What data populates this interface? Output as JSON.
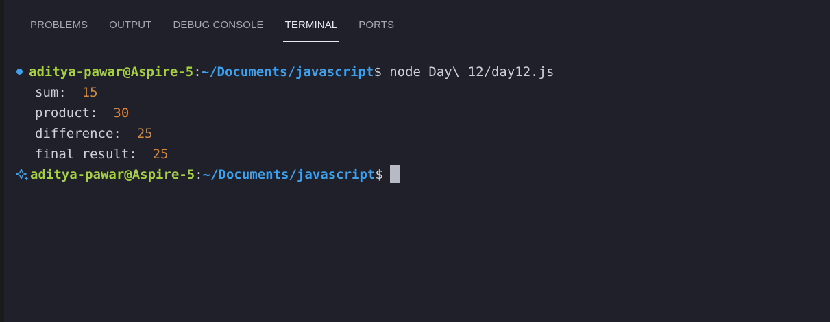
{
  "tabs": [
    {
      "label": "PROBLEMS"
    },
    {
      "label": "OUTPUT"
    },
    {
      "label": "DEBUG CONSOLE"
    },
    {
      "label": "TERMINAL",
      "active": true
    },
    {
      "label": "PORTS"
    }
  ],
  "terminal": {
    "prompt": {
      "user_host": "aditya-pawar@Aspire-5",
      "colon": ":",
      "path": "~/Documents/javascript",
      "dollar": "$"
    },
    "command": " node Day\\ 12/day12.js",
    "output": [
      {
        "label": "sum:  ",
        "value": "15"
      },
      {
        "label": "product:  ",
        "value": "30"
      },
      {
        "label": "difference:  ",
        "value": "25"
      },
      {
        "label": "final result:  ",
        "value": "25"
      }
    ]
  },
  "colors": {
    "background": "#1f2029",
    "prompt_user": "#a6cf42",
    "prompt_path": "#3fa1ec",
    "number": "#d5883d",
    "success_dot": "#3fa1ec"
  },
  "icons": {
    "command_status": "circle-dot-icon",
    "prompt_marker": "sparkle-icon"
  }
}
